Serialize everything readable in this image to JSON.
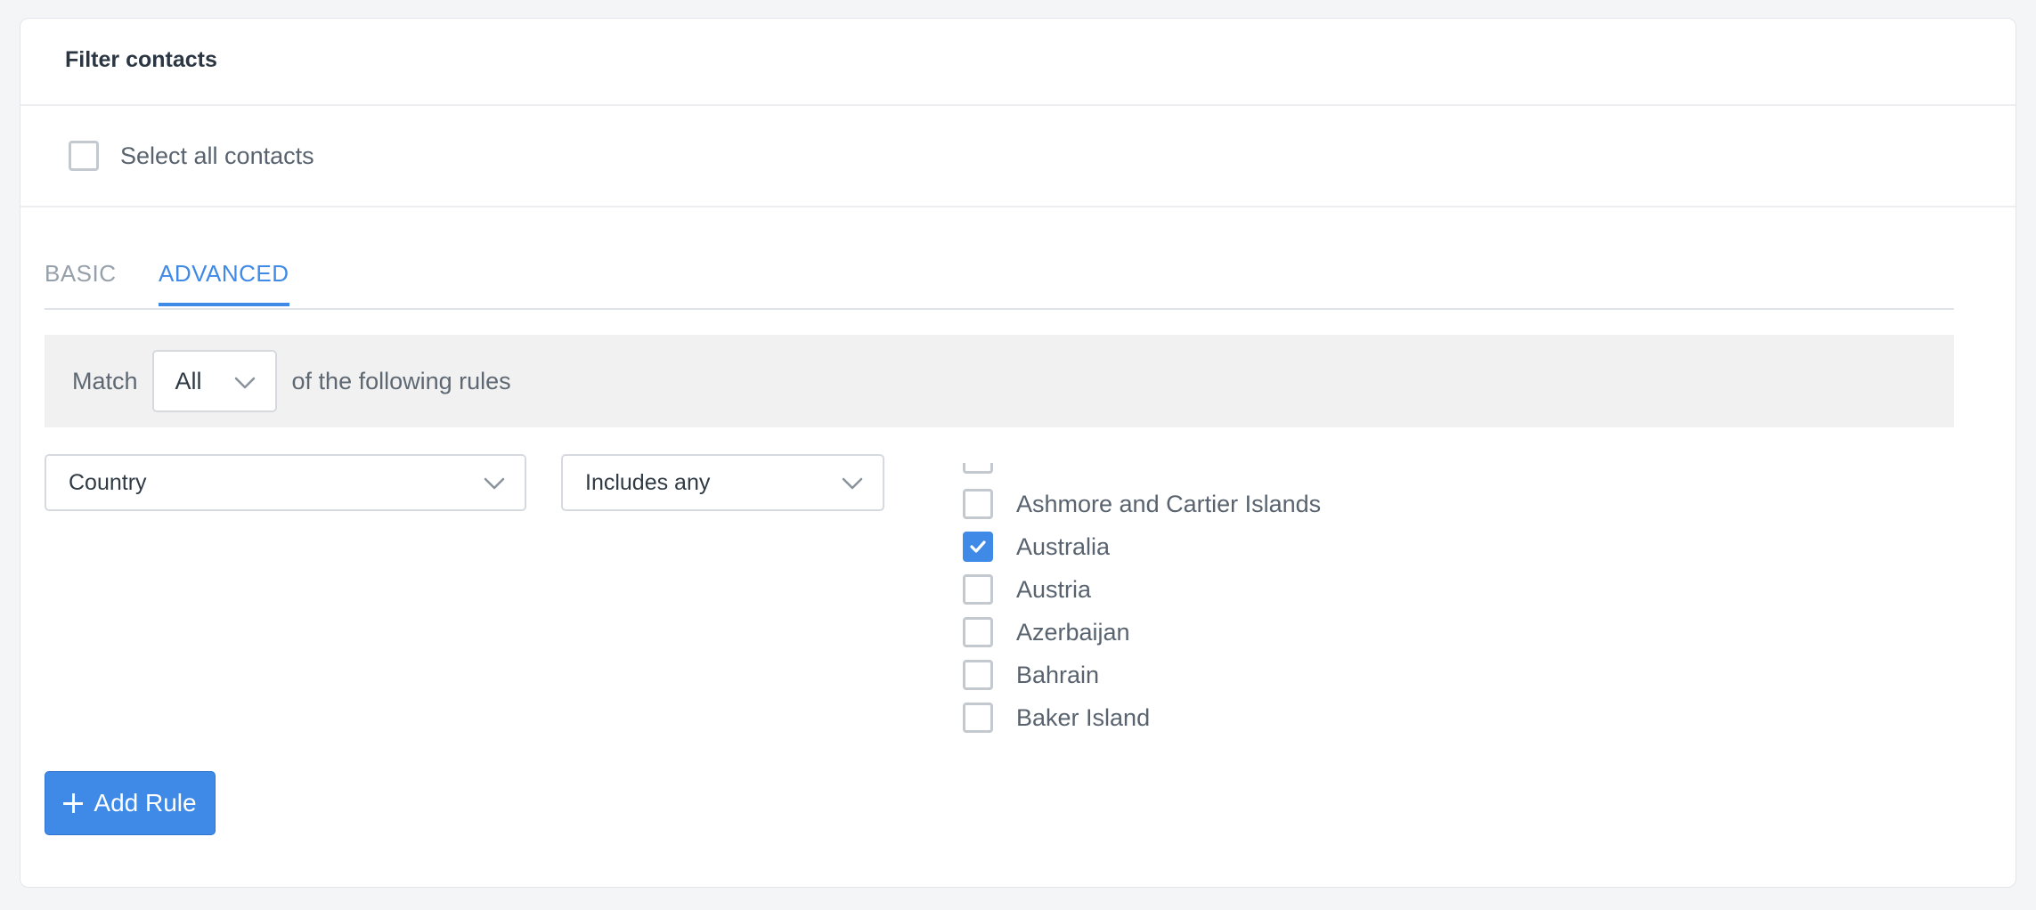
{
  "card": {
    "title": "Filter contacts",
    "select_all_label": "Select all contacts"
  },
  "tabs": [
    {
      "label": "BASIC",
      "active": false
    },
    {
      "label": "ADVANCED",
      "active": true
    }
  ],
  "match": {
    "prefix": "Match",
    "selected": "All",
    "suffix": "of the following rules"
  },
  "rule": {
    "field": "Country",
    "operator": "Includes any",
    "options": [
      {
        "label": "Ashmore and Cartier Islands",
        "checked": false
      },
      {
        "label": "Australia",
        "checked": true
      },
      {
        "label": "Austria",
        "checked": false
      },
      {
        "label": "Azerbaijan",
        "checked": false
      },
      {
        "label": "Bahrain",
        "checked": false
      },
      {
        "label": "Baker Island",
        "checked": false
      }
    ]
  },
  "add_rule_label": "Add Rule",
  "icons": {
    "chevron": "chevron-down-icon",
    "check": "check-icon",
    "plus": "plus-icon"
  },
  "colors": {
    "accent": "#3f8ae6",
    "background": "#f4f5f7",
    "match_bar": "#f1f1f1"
  }
}
